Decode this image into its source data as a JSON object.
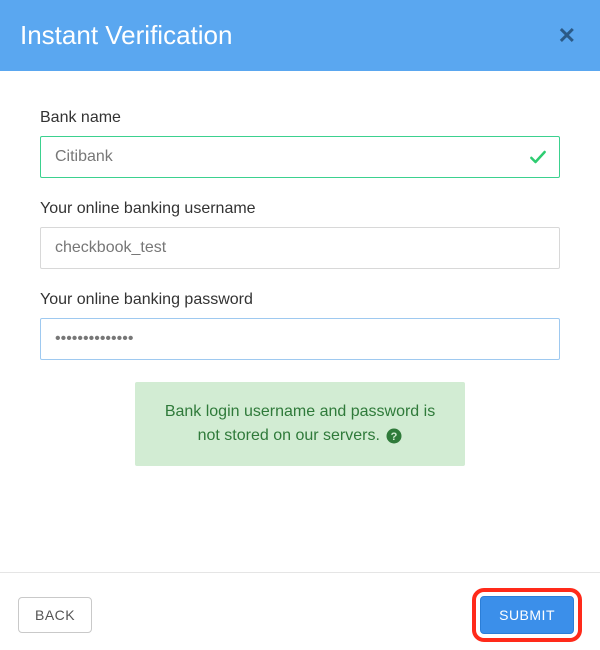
{
  "header": {
    "title": "Instant Verification"
  },
  "form": {
    "bank_name": {
      "label": "Bank name",
      "value": "Citibank"
    },
    "username": {
      "label": "Your online banking username",
      "value": "checkbook_test"
    },
    "password": {
      "label": "Your online banking password",
      "value": "••••••••••••••"
    }
  },
  "notice": {
    "text": "Bank login username and password is not stored on our servers."
  },
  "footer": {
    "back_label": "BACK",
    "submit_label": "SUBMIT"
  }
}
